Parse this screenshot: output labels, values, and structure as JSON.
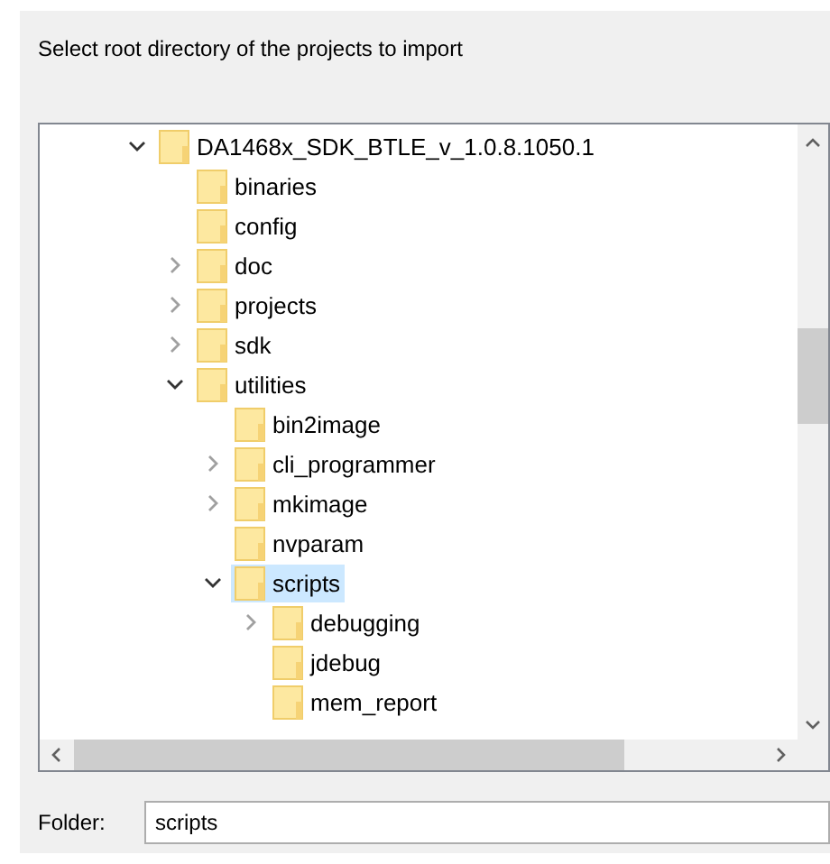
{
  "prompt": "Select root directory of the projects to import",
  "tree": [
    {
      "label": "DA1468x_SDK_BTLE_v_1.0.8.1050.1",
      "expanded": true,
      "selected": false,
      "children": [
        {
          "label": "binaries",
          "selected": false
        },
        {
          "label": "config",
          "selected": false
        },
        {
          "label": "doc",
          "expanded": false,
          "selected": false
        },
        {
          "label": "projects",
          "expanded": false,
          "selected": false
        },
        {
          "label": "sdk",
          "expanded": false,
          "selected": false
        },
        {
          "label": "utilities",
          "expanded": true,
          "selected": false,
          "children": [
            {
              "label": "bin2image",
              "selected": false
            },
            {
              "label": "cli_programmer",
              "expanded": false,
              "selected": false
            },
            {
              "label": "mkimage",
              "expanded": false,
              "selected": false
            },
            {
              "label": "nvparam",
              "selected": false
            },
            {
              "label": "scripts",
              "expanded": true,
              "selected": true,
              "children": [
                {
                  "label": "debugging",
                  "expanded": false,
                  "selected": false
                },
                {
                  "label": "jdebug",
                  "selected": false
                },
                {
                  "label": "mem_report",
                  "selected": false
                }
              ]
            }
          ]
        }
      ]
    }
  ],
  "folder": {
    "label": "Folder:",
    "value": "scripts"
  }
}
